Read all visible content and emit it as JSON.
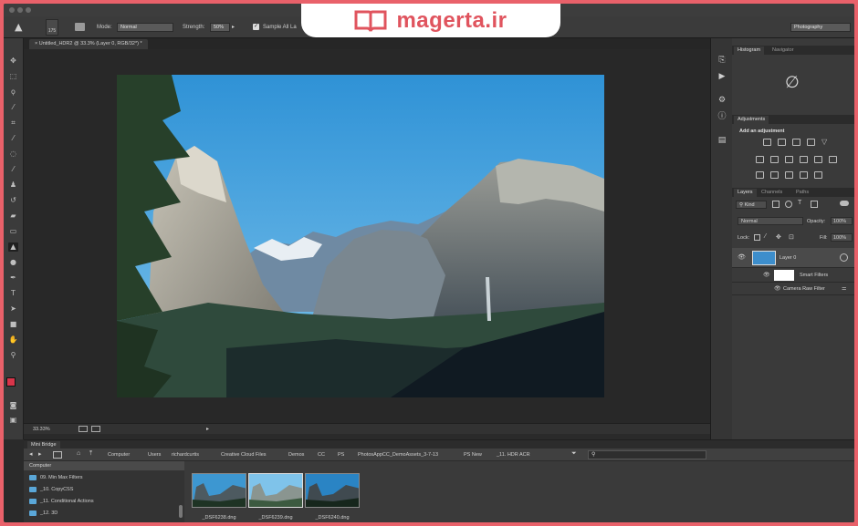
{
  "watermark": {
    "brand": "magerta.ir",
    "logo_icon": "open-book-icon",
    "color": "#e0545e"
  },
  "options_bar": {
    "brush_size": "175",
    "mode_label": "Mode:",
    "mode_value": "Normal",
    "strength_label": "Strength:",
    "strength_value": "50%",
    "sample_all_label": "Sample All La",
    "workspace": "Photography"
  },
  "document": {
    "tab_title": "Untitled_HDR2 @ 33.3% (Layer 0, RGB/32*) *",
    "zoom": "33.33%"
  },
  "panels": {
    "histogram_tabs": [
      "Histogram",
      "Navigator"
    ],
    "histogram_icon": "no-sign-icon",
    "adjustments_tab": "Adjustments",
    "adjustments_title": "Add an adjustment",
    "layers_tabs": [
      "Layers",
      "Channels",
      "Paths"
    ],
    "filter_kind": "Kind",
    "blend_mode": "Normal",
    "opacity_label": "Opacity:",
    "opacity_value": "100%",
    "lock_label": "Lock:",
    "fill_label": "Fill:",
    "fill_value": "100%",
    "layers": [
      {
        "name": "Layer 0"
      },
      {
        "name": "Smart Filters"
      },
      {
        "name": "Camera Raw Filter"
      }
    ]
  },
  "bridge": {
    "title": "Mini Bridge",
    "breadcrumbs": [
      "Computer",
      "Users",
      "richardcurtis",
      "Creative Cloud Files",
      "Demos",
      "CC",
      "PS",
      "PhotosAppCC_DemoAssets_3-7-13",
      "PS New",
      "_11. HDR ACR"
    ],
    "folder_header": "Computer",
    "folders": [
      "09. Min Max Filters",
      "_10. CopyCSS",
      "_11. Conditional Actions",
      "_12. 3D"
    ],
    "thumbnails": [
      "_DSF6238.dng",
      "_DSF6239.dng",
      "_DSF6240.dng"
    ]
  }
}
